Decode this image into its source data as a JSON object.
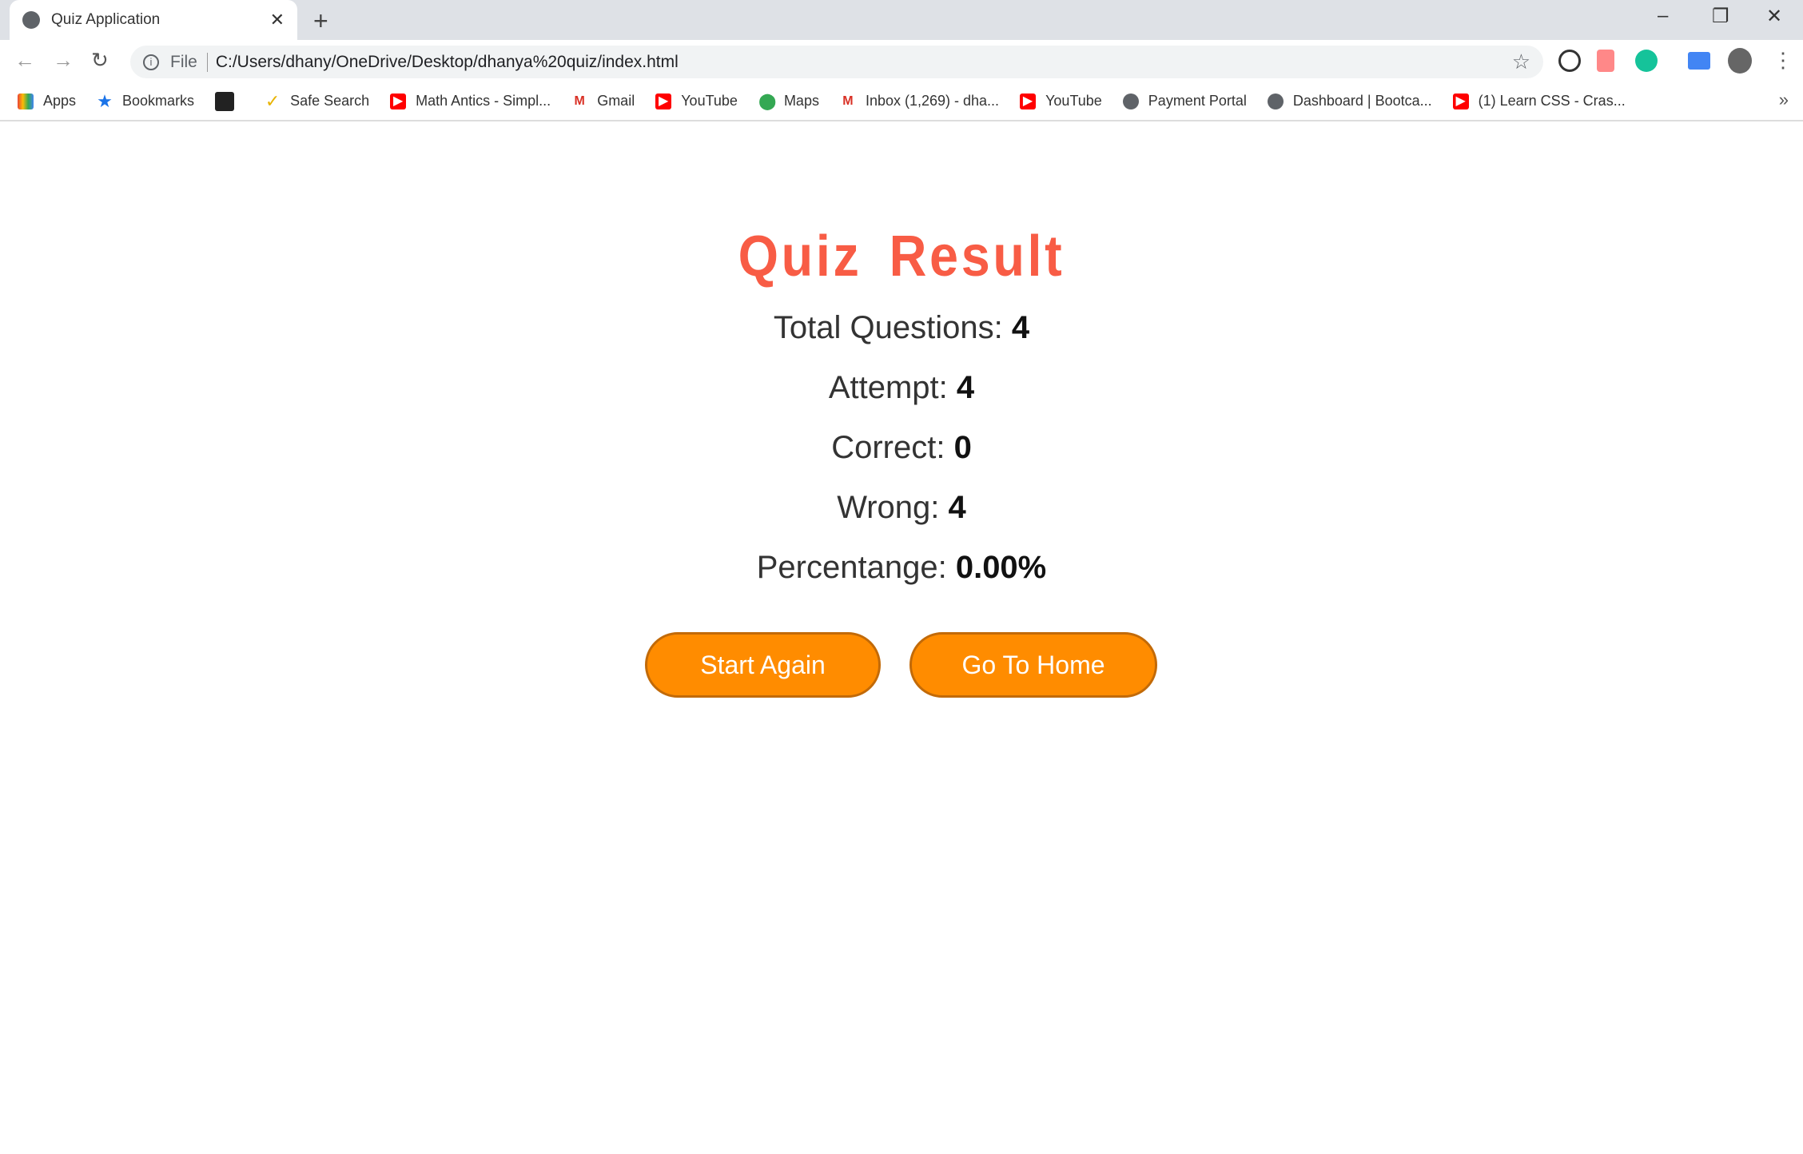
{
  "browser": {
    "tab_title": "Quiz Application",
    "url_scheme": "File",
    "url": "C:/Users/dhany/OneDrive/Desktop/dhanya%20quiz/index.html",
    "bookmarks": [
      "Apps",
      "Bookmarks",
      "",
      "Safe Search",
      "Math Antics - Simpl...",
      "Gmail",
      "YouTube",
      "Maps",
      "Inbox (1,269) - dha...",
      "YouTube",
      "Payment Portal",
      "Dashboard | Bootca...",
      "(1) Learn CSS - Cras..."
    ]
  },
  "result": {
    "title": "Quiz Result",
    "total_label": "Total Questions:",
    "total": "4",
    "attempt_label": "Attempt:",
    "attempt": "4",
    "correct_label": "Correct:",
    "correct": "0",
    "wrong_label": "Wrong:",
    "wrong": "4",
    "percent_label": "Percentange:",
    "percent": "0.00%"
  },
  "buttons": {
    "start_again": "Start Again",
    "go_home": "Go To Home"
  },
  "colors": {
    "title": "#f85c45",
    "button": "#ff8c00"
  }
}
